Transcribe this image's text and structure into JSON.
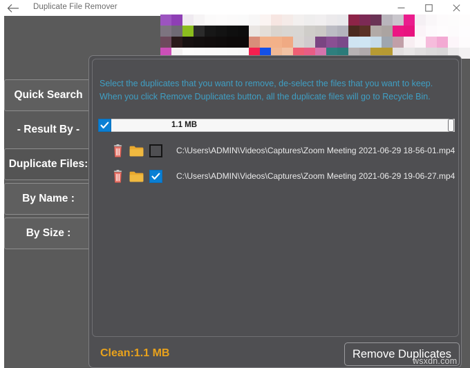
{
  "window": {
    "title": "Duplicate File Remover",
    "back_icon": "back-arrow-icon",
    "minimize_label": "—",
    "maximize_label": "☐",
    "close_label": "✕"
  },
  "sidebar": {
    "items": [
      {
        "label": "Quick Search",
        "style": "button",
        "active": false
      },
      {
        "label": "- Result By -",
        "style": "plain",
        "active": false
      },
      {
        "label": "Duplicate Files:",
        "style": "button",
        "active": true
      },
      {
        "label": "By Name :",
        "style": "button",
        "active": false
      },
      {
        "label": "By Size :",
        "style": "button",
        "active": false
      }
    ]
  },
  "dialog": {
    "instructions": "Select the duplicates that you want to remove, de-select the files that you want to keep. When you click Remove Duplicates button, all the duplicate files will go to Recycle Bin.",
    "group": {
      "checked": true,
      "size_label": "1.1 MB"
    },
    "files": [
      {
        "delete_icon": "trash-icon",
        "folder_icon": "folder-icon",
        "checked": false,
        "path": "C:\\Users\\ADMIN\\Videos\\Captures\\Zoom Meeting 2021-06-29 18-56-01.mp4"
      },
      {
        "delete_icon": "trash-icon",
        "folder_icon": "folder-icon",
        "checked": true,
        "path": "C:\\Users\\ADMIN\\Videos\\Captures\\Zoom Meeting 2021-06-29 19-06-27.mp4"
      }
    ]
  },
  "footer": {
    "clean_label": "Clean:1.1 MB",
    "remove_button": "Remove Duplicates",
    "watermark": "wsxdn.com"
  },
  "colors": {
    "app_background": "#5a5a5a",
    "dialog_background": "#4f4f52",
    "instruction_text": "#3f9fc4",
    "clean_text": "#e9a21c",
    "checkbox_accent": "#0a7fd4",
    "folder_icon": "#eaa92e",
    "trash_icon": "#e0675f",
    "titlebar_background": "#ffffff"
  },
  "mosaic": {
    "description": "pixelated-censored-banner",
    "cols": 28,
    "rows": 4,
    "cell": 16,
    "rows_colors": [
      [
        "#9c54c0",
        "#8e3fb5",
        "#efeaf0",
        "#f6f4f5",
        "#fbfafa",
        "#fcfbfb",
        "#fbfafa",
        "#fafafa",
        "#f8f7f7",
        "#fbf4f2",
        "#f7e6e2",
        "#f5ebe8",
        "#f3f0ef",
        "#efeeee",
        "#f1eff0",
        "#eceaec",
        "#e9e9ec",
        "#8d2448",
        "#7c2a55",
        "#6a3355",
        "#b9b5bc",
        "#c9c6cc",
        "#ea1d8d",
        "#f5f0f4",
        "#faf7f9",
        "#fdfbfc",
        "#fdfcfc",
        "#fefdfd"
      ],
      [
        "#7d7480",
        "#6f6a74",
        "#8bbd1e",
        "#2b2b2b",
        "#171717",
        "#131313",
        "#0f0f0f",
        "#0d0d0d",
        "#eae6e3",
        "#e4ded8",
        "#dad4ce",
        "#d9d6d2",
        "#d8d6d3",
        "#cfcdc9",
        "#cbc9c6",
        "#bcbcc4",
        "#b4b4bd",
        "#4b2a20",
        "#5a3126",
        "#b2aaa7",
        "#aba4a1",
        "#ec1683",
        "#e8147f",
        "#fbf4f8",
        "#fdfafc",
        "#fefcfd",
        "#fdfbfc",
        "#fefdfe"
      ],
      [
        "#6d4a5c",
        "#2a1a1a",
        "#171111",
        "#130f0f",
        "#110d0d",
        "#0f0c0c",
        "#0d0a0a",
        "#0d0a0a",
        "#d98d7a",
        "#f2b189",
        "#f3b189",
        "#f0aa83",
        "#d9d4d2",
        "#d0cbcd",
        "#7a4582",
        "#8a4f93",
        "#7b4a8a",
        "#cfe4f2",
        "#cfe5f3",
        "#c7dcea",
        "#9fa6af",
        "#c19fa8",
        "#f8eef2",
        "#fdf8fa",
        "#f6bcdc",
        "#f3a9d3",
        "#fdf6fa",
        "#fefcfd"
      ],
      [
        "#cc4fb8",
        "#f4f2f2",
        "#fdfcfc",
        "#fcfbfb",
        "#fbfafa",
        "#fafafa",
        "#f9f9f9",
        "#f8f8f8",
        "#f41f4f",
        "#1350e8",
        "#f0b894",
        "#f2c2a3",
        "#ee5f74",
        "#e85d85",
        "#d474ad",
        "#2e7f7e",
        "#2b7b7a",
        "#b7b2b4",
        "#b0aaac",
        "#b79b33",
        "#b69a33",
        "#e2dfe0",
        "#e8e6e7",
        "#e1dfe0",
        "#dcdadb",
        "#d9d7d8",
        "#eceaeb",
        "#f3f1f2"
      ]
    ],
    "rows_colors_right": [
      [
        "#fcfbfb",
        "#fdfcfc",
        "#fdfcfc",
        "#fefdfd",
        "#fefdfd",
        "#fdfcfc"
      ],
      [
        "#fdfbfc",
        "#fefcfd",
        "#fefdfd",
        "#fefdfd",
        "#fdfcfc",
        "#e8ba98"
      ],
      [
        "#a82bb8",
        "#c5189a",
        "#d6265c",
        "#e0352f",
        "#e24536",
        "#f3f0f1"
      ],
      [
        "#e5189a",
        "#ee2b76",
        "#f03a2e",
        "#f24b2a",
        "#ef5140",
        "#f7f5f6"
      ]
    ]
  }
}
